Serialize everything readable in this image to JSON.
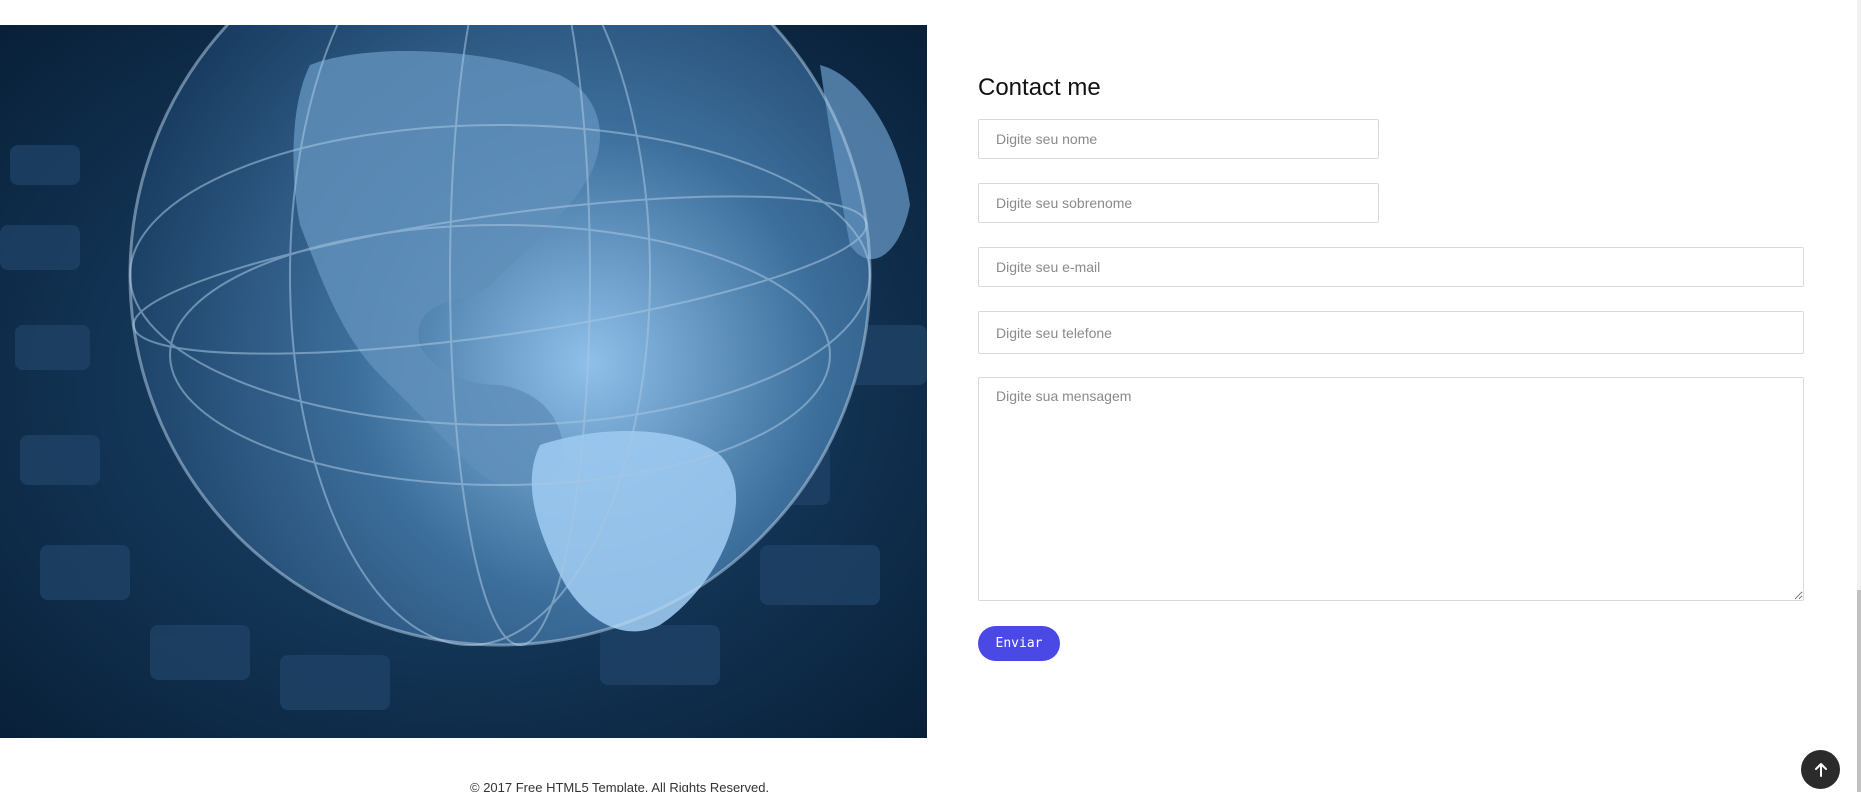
{
  "contact": {
    "title": "Contact me",
    "name_placeholder": "Digite seu nome",
    "lastname_placeholder": "Digite seu sobrenome",
    "email_placeholder": "Digite seu e-mail",
    "phone_placeholder": "Digite seu telefone",
    "message_placeholder": "Digite sua mensagem",
    "send_label": "Enviar"
  },
  "footer": {
    "copyright": "© 2017 Free HTML5 Template. All Rights Reserved."
  },
  "colors": {
    "accent": "#4b49e6",
    "back_to_top": "#2b2b2b"
  },
  "icons": {
    "back_to_top": "arrow-up-icon"
  }
}
